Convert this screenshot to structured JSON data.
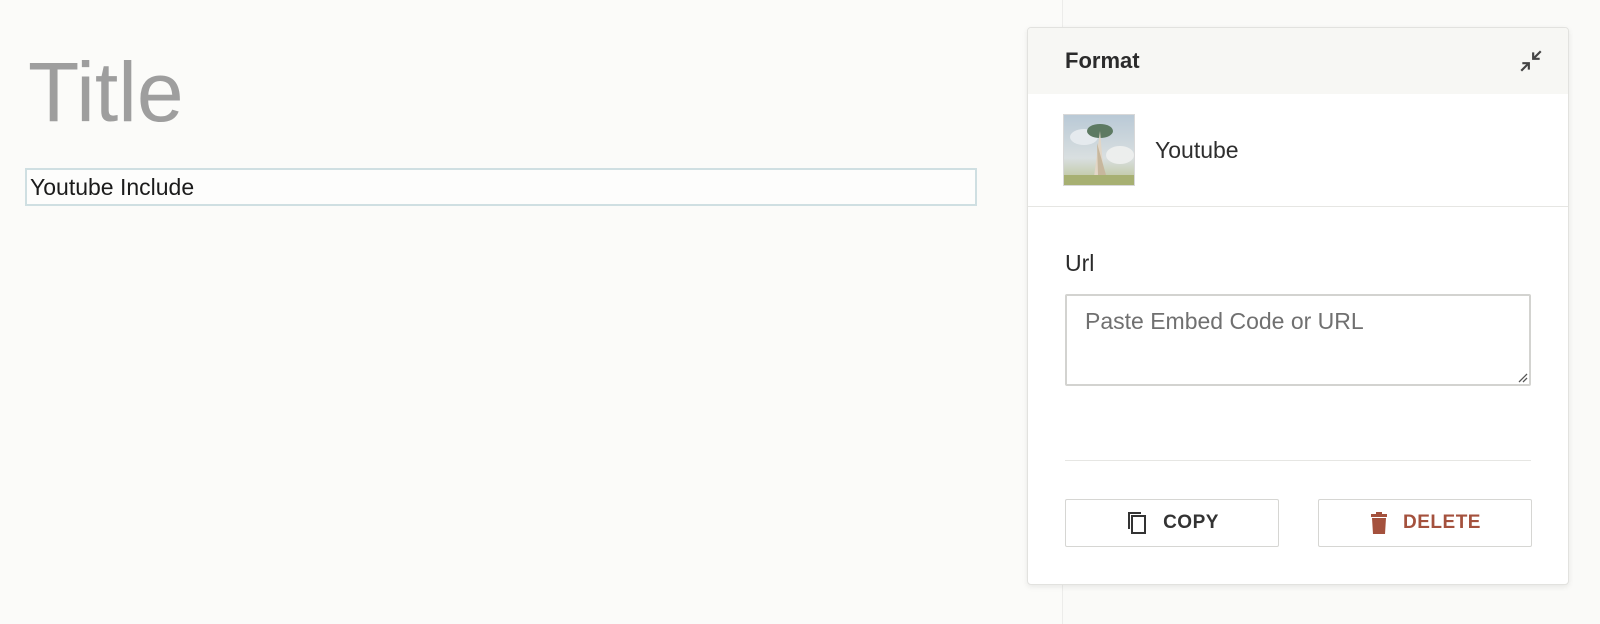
{
  "document": {
    "title": "Title",
    "block_label": "Youtube Include"
  },
  "panel": {
    "title": "Format",
    "collapse_icon": "collapse-arrows-icon",
    "embed": {
      "name": "Youtube",
      "thumbnail": "painting-thumbnail"
    },
    "url_field": {
      "label": "Url",
      "value": "",
      "placeholder": "Paste Embed Code or URL"
    },
    "actions": {
      "copy_label": "COPY",
      "copy_icon": "copy-icon",
      "delete_label": "DELETE",
      "delete_icon": "trash-icon"
    }
  },
  "colors": {
    "delete": "#a4513d",
    "block_border": "#cfdfe2",
    "title_gray": "#9e9e9e"
  }
}
